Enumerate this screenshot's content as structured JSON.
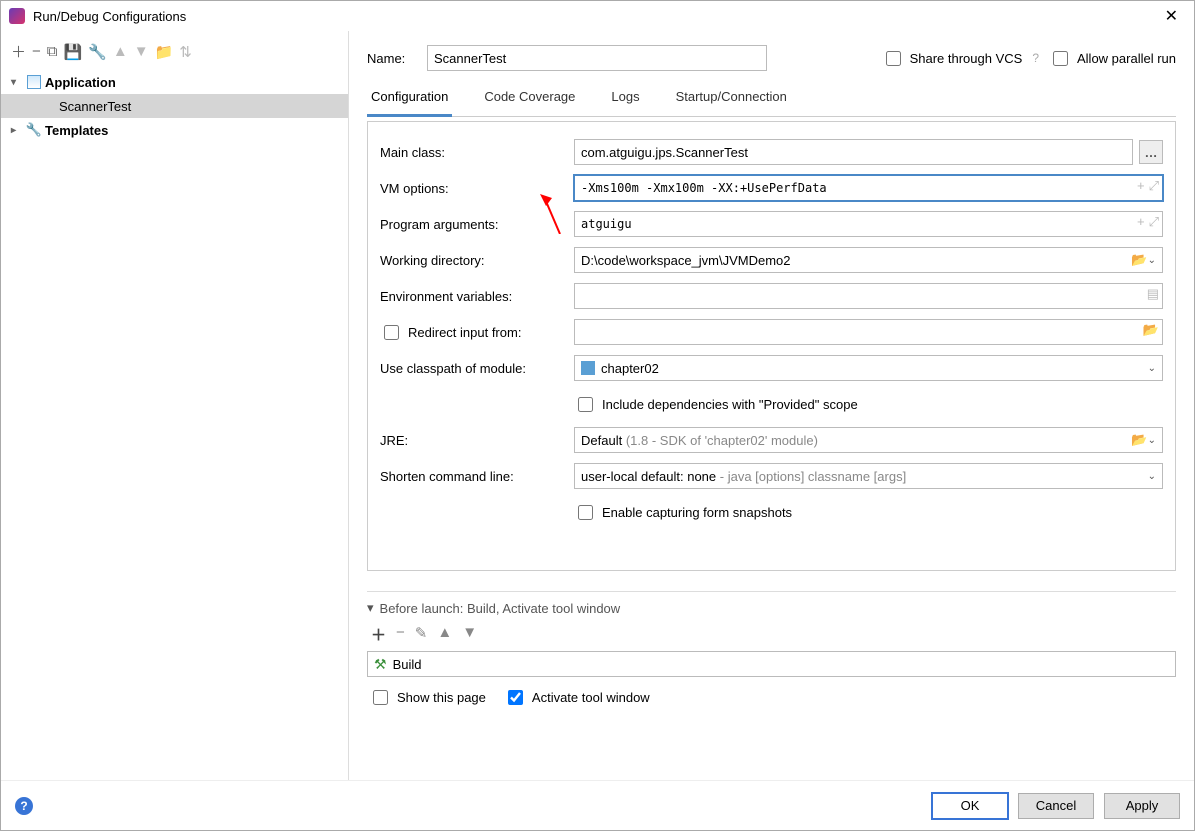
{
  "window": {
    "title": "Run/Debug Configurations"
  },
  "sidebar": {
    "items": [
      {
        "label": "Application",
        "expanded": true,
        "bold": true
      },
      {
        "label": "ScannerTest",
        "selected": true,
        "indent": 2
      },
      {
        "label": "Templates",
        "bold": true,
        "chev": "▶",
        "icon": "wrench"
      }
    ]
  },
  "header": {
    "name_label": "Name:",
    "name_value": "ScannerTest",
    "share_label": "Share through VCS",
    "allow_label": "Allow parallel run"
  },
  "tabs": [
    "Configuration",
    "Code Coverage",
    "Logs",
    "Startup/Connection"
  ],
  "active_tab": 0,
  "form": {
    "main_class": {
      "label": "Main class:",
      "value": "com.atguigu.jps.ScannerTest"
    },
    "vm_options": {
      "label": "VM options:",
      "value": "-Xms100m -Xmx100m -XX:+UsePerfData"
    },
    "program_args": {
      "label": "Program arguments:",
      "value": "atguigu"
    },
    "working_dir": {
      "label": "Working directory:",
      "value": "D:\\code\\workspace_jvm\\JVMDemo2"
    },
    "env": {
      "label": "Environment variables:",
      "value": ""
    },
    "redirect": {
      "label": "Redirect input from:"
    },
    "classpath": {
      "label": "Use classpath of module:",
      "value": "chapter02"
    },
    "include_provided": "Include dependencies with \"Provided\" scope",
    "jre": {
      "label": "JRE:",
      "value": "Default",
      "hint": "(1.8 - SDK of 'chapter02' module)"
    },
    "shorten": {
      "label": "Shorten command line:",
      "value": "user-local default: none",
      "hint": " - java [options] classname [args]"
    },
    "enable_snapshots": "Enable capturing form snapshots"
  },
  "before": {
    "title": "Before launch: Build, Activate tool window",
    "build": "Build",
    "show_page": "Show this page",
    "activate": "Activate tool window"
  },
  "buttons": {
    "ok": "OK",
    "cancel": "Cancel",
    "apply": "Apply"
  }
}
